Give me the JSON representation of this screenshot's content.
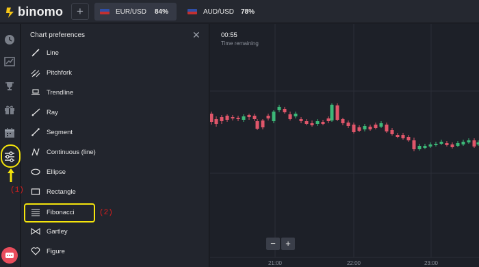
{
  "app": {
    "name": "binomo"
  },
  "topbar": {
    "add_label": "+",
    "tabs": [
      {
        "name": "EUR/USD",
        "percent": "84%",
        "active": true
      },
      {
        "name": "AUD/USD",
        "percent": "78%",
        "active": false
      }
    ]
  },
  "sidebar": {
    "icons": [
      "clock-icon",
      "chart-trend-icon",
      "trophy-icon",
      "gift-icon",
      "calendar-icon",
      "sliders-icon"
    ]
  },
  "panel": {
    "title": "Chart preferences",
    "tools": [
      {
        "label": "Line",
        "icon": "line-icon"
      },
      {
        "label": "Pitchfork",
        "icon": "pitchfork-icon"
      },
      {
        "label": "Trendline",
        "icon": "trendline-icon"
      },
      {
        "label": "Ray",
        "icon": "ray-icon"
      },
      {
        "label": "Segment",
        "icon": "segment-icon"
      },
      {
        "label": "Continuous (line)",
        "icon": "continuous-line-icon"
      },
      {
        "label": "Ellipse",
        "icon": "ellipse-icon"
      },
      {
        "label": "Rectangle",
        "icon": "rectangle-icon"
      },
      {
        "label": "Fibonacci",
        "icon": "fibonacci-icon"
      },
      {
        "label": "Gartley",
        "icon": "gartley-icon"
      },
      {
        "label": "Figure",
        "icon": "heart-icon"
      }
    ]
  },
  "chart": {
    "timer_value": "00:55",
    "timer_label": "Time remaining",
    "zoom_out": "−",
    "zoom_in": "+",
    "time_ticks": [
      "21:00",
      "22:00",
      "23:00"
    ]
  },
  "annotations": {
    "label_1": "(1)",
    "label_2": "(2)"
  },
  "colors": {
    "up": "#3cb878",
    "down": "#e0566a",
    "highlight": "#f5e50c",
    "annotation_text": "#e11d1d"
  }
}
